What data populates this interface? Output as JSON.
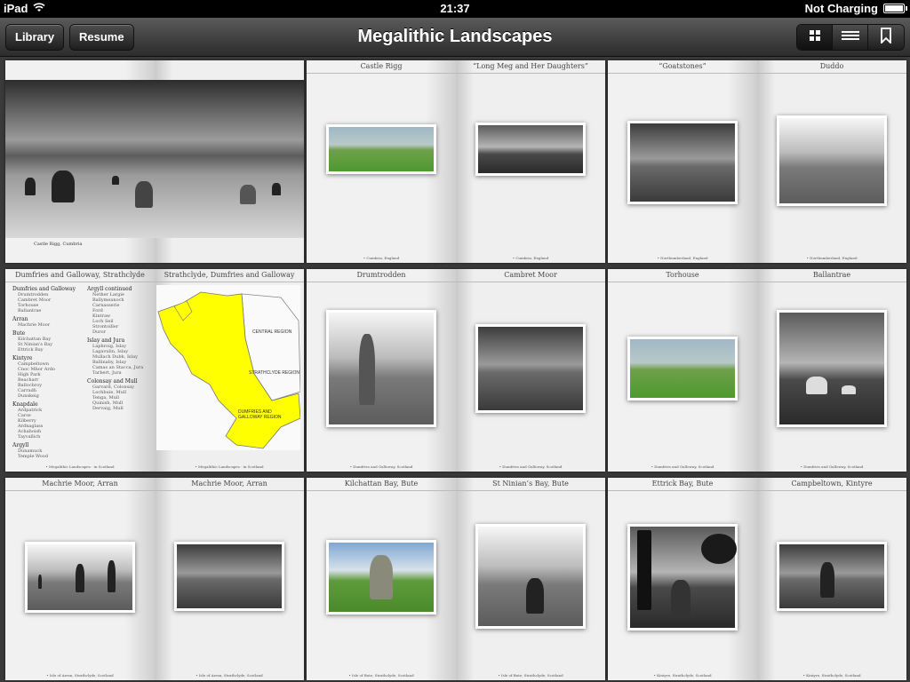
{
  "status": {
    "device": "iPad",
    "time": "21:37",
    "battery_text": "Not Charging"
  },
  "toolbar": {
    "library_label": "Library",
    "resume_label": "Resume",
    "title": "Megalithic Landscapes"
  },
  "spreads": [
    {
      "left_title": "",
      "right_title": "",
      "caption": "Castle Rigg, Cumbria"
    },
    {
      "left_title": "Castle Rigg",
      "right_title": "“Long Meg and Her Daughters”",
      "footer": "• Cumbria, England"
    },
    {
      "left_title": "“Goatstones”",
      "right_title": "Duddo",
      "footer": "• Northumberland, England"
    },
    {
      "left_title": "Dumfries and Galloway, Strathclyde",
      "right_title": "Strathclyde, Dumfries and Galloway",
      "footer": "• Megalithic Landscapes · in Scotland"
    },
    {
      "left_title": "Drumtrodden",
      "right_title": "Cambret Moor",
      "footer": "• Dumfries and Galloway, Scotland"
    },
    {
      "left_title": "Torhouse",
      "right_title": "Ballantrae",
      "footer": "• Dumfries and Galloway, Scotland"
    },
    {
      "left_title": "Machrie Moor, Arran",
      "right_title": "Machrie Moor, Arran",
      "footer": "• Isle of Arran, Strathclyde, Scotland"
    },
    {
      "left_title": "Kilchattan Bay, Bute",
      "right_title": "St Ninian’s Bay, Bute",
      "footer": "• Isle of Bute, Strathclyde, Scotland"
    },
    {
      "left_title": "Ettrick Bay, Bute",
      "right_title": "Campbeltown, Kintyre",
      "footer": "• Kintyre, Strathclyde, Scotland"
    }
  ],
  "index": {
    "col1": [
      {
        "h": "Dumfries and Galloway",
        "items": [
          "Drumtrodden",
          "Cambret Moor",
          "Torhouse",
          "Ballantrae"
        ]
      },
      {
        "h": "Arran",
        "items": [
          "Machrie Moor"
        ]
      },
      {
        "h": "Bute",
        "items": [
          "Kilchattan Bay",
          "St Ninian's Bay",
          "Ettrick Bay"
        ]
      },
      {
        "h": "Kintyre",
        "items": [
          "Campbeltown",
          "Cnoc Mhor Ardo",
          "High Park",
          "Beacharr",
          "Ballochroy",
          "Carradh",
          "Dunskeig"
        ]
      },
      {
        "h": "Knapdale",
        "items": [
          "Ardpatrick",
          "Carse",
          "Kilberry",
          "Ardnaglass",
          "Achahoish",
          "Tayvallich"
        ]
      },
      {
        "h": "Argyll",
        "items": [
          "Dunamuck",
          "Temple Wood"
        ]
      }
    ],
    "col2": [
      {
        "h": "Argyll continued",
        "items": [
          "Nether Largie",
          "Ballymeanoch",
          "Carnasserie",
          "Ford",
          "Kintraw",
          "Loch Seil",
          "Strontoiller",
          "Duror"
        ]
      },
      {
        "h": "Islay and Jura",
        "items": [
          "Laphroig, Islay",
          "Lagavulin, Islay",
          "Mullach Dubh, Islay",
          "Ballinaby, Islay",
          "Camas an Stacca, Jura",
          "Tarbert, Jura"
        ]
      },
      {
        "h": "Colonsay and Mull",
        "items": [
          "Garvard, Colonsay",
          "Lochbuie, Mull",
          "Tenga, Mull",
          "Quinish, Mull",
          "Dervaig, Mull"
        ]
      }
    ],
    "map_labels": [
      "CENTRAL REGION",
      "STRATHCLYDE REGION",
      "DUMFRIES AND GALLOWAY REGION"
    ]
  }
}
